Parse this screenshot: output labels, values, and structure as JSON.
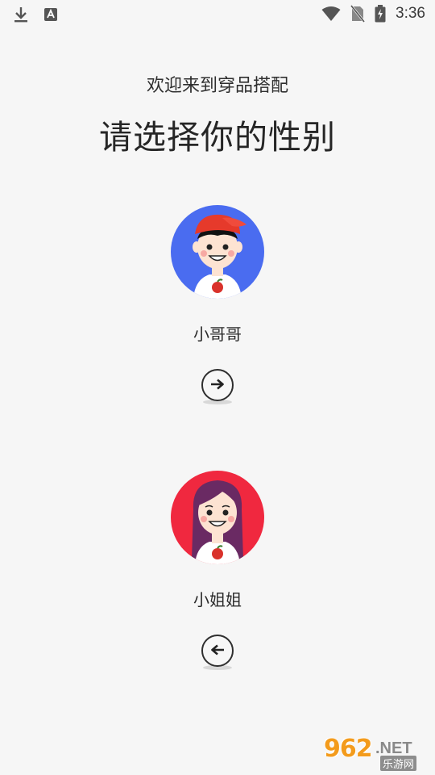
{
  "status_bar": {
    "time": "3:36",
    "icons": [
      "download-icon",
      "text-a-icon",
      "wifi-icon",
      "no-sim-icon",
      "battery-charging-icon"
    ]
  },
  "header": {
    "welcome": "欢迎来到穿品搭配",
    "title": "请选择你的性别"
  },
  "options": [
    {
      "label": "小哥哥",
      "avatar_bg": "#4a6cf0",
      "arrow": "arrow-right-icon"
    },
    {
      "label": "小姐姐",
      "avatar_bg": "#f0283f",
      "arrow": "arrow-left-icon"
    }
  ],
  "watermark": {
    "number": "962",
    "domain": ".NET",
    "sub": "乐游网"
  }
}
